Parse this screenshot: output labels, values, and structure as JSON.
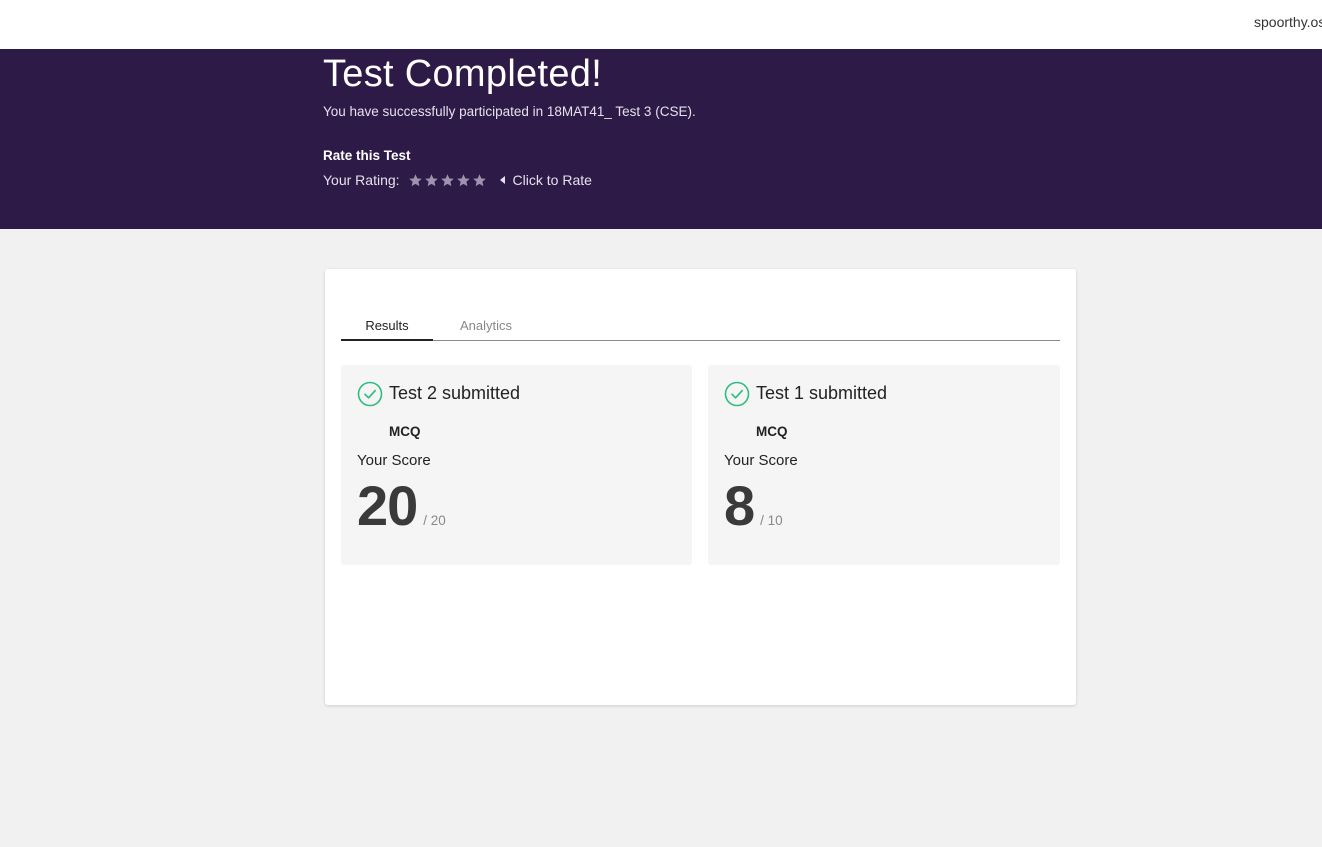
{
  "topbar": {
    "user_name": "spoorthy.os"
  },
  "hero": {
    "title": "Test Completed!",
    "subtitle": "You have successfully participated in 18MAT41_ Test 3 (CSE).",
    "rate_heading": "Rate this Test",
    "rating_label": "Your Rating:",
    "rating_value": 0,
    "rating_max": 5,
    "click_to_rate": "Click to Rate"
  },
  "tabs": [
    {
      "label": "Results",
      "active": true
    },
    {
      "label": "Analytics",
      "active": false
    }
  ],
  "results": [
    {
      "title": "Test 2 submitted",
      "type": "MCQ",
      "score_label": "Your Score",
      "score": "20",
      "total": "/ 20"
    },
    {
      "title": "Test 1 submitted",
      "type": "MCQ",
      "score_label": "Your Score",
      "score": "8",
      "total": "/ 10"
    }
  ],
  "colors": {
    "hero_bg": "#2e1a47",
    "check_green": "#2ebd7e",
    "star_empty": "#9d93ab"
  }
}
